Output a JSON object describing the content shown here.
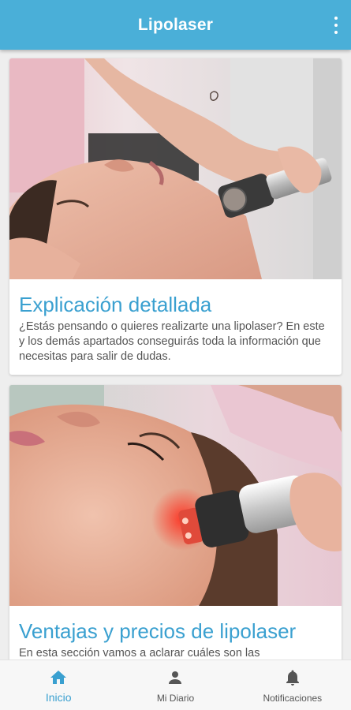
{
  "appbar": {
    "title": "Lipolaser",
    "overflow_icon": "more-vert-icon",
    "color": "#4aafd8"
  },
  "cards": [
    {
      "image": "photo-lipolaser-treatment-face",
      "title": "Explicación detallada",
      "text": "¿Estás pensando o quieres realizarte una lipolaser? En este y los demás apartados conseguirás toda la información que necesitas para salir de dudas."
    },
    {
      "image": "photo-lipolaser-red-light-jaw",
      "title": "Ventajas y precios de lipolaser",
      "text": "En esta sección vamos a aclarar cuáles son las"
    }
  ],
  "bottom_nav": {
    "items": [
      {
        "label": "Inicio",
        "icon": "home-icon",
        "active": true
      },
      {
        "label": "Mi Diario",
        "icon": "person-icon",
        "active": false
      },
      {
        "label": "Notificaciones",
        "icon": "bell-icon",
        "active": false
      }
    ],
    "active_color": "#3aa0d0",
    "inactive_color": "#555555"
  }
}
